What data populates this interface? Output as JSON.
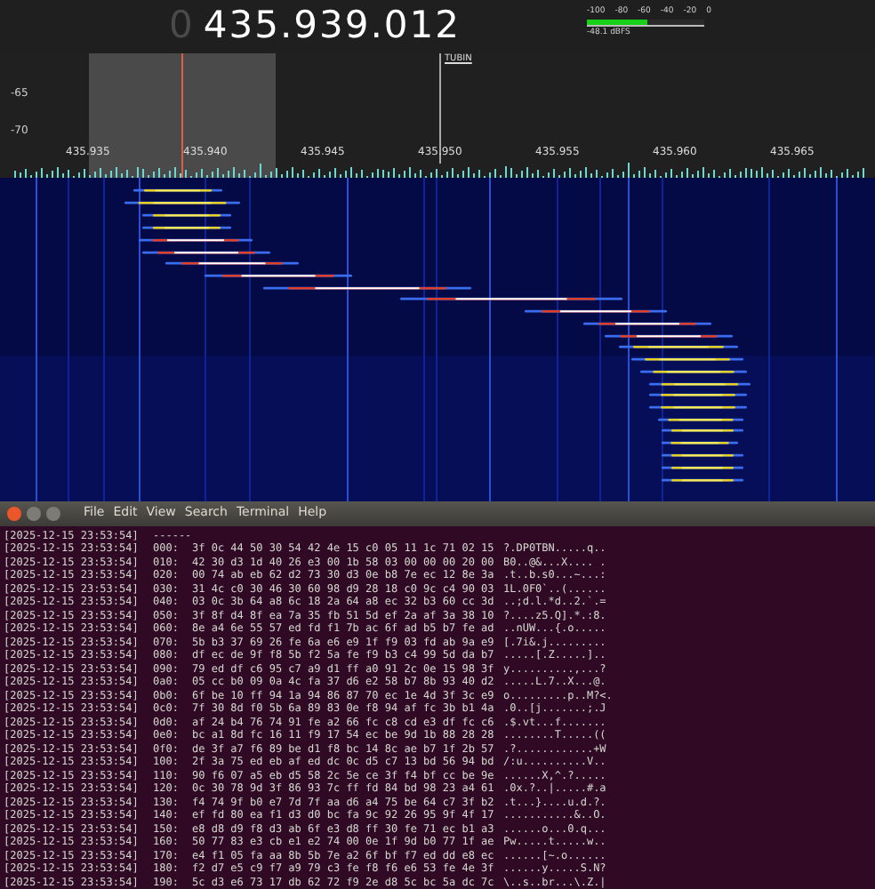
{
  "frequency": {
    "leading_digit": "0",
    "value": "435.939.012"
  },
  "meter": {
    "scale": [
      "-100",
      "-80",
      "-60",
      "-40",
      "-20",
      "0"
    ],
    "level": 0.52,
    "reading": "-48.1 dBFS"
  },
  "spectrum": {
    "y_labels": [
      "-65",
      "-70"
    ],
    "x_labels": [
      "435.935",
      "435.940",
      "435.945",
      "435.950",
      "435.955",
      "435.960",
      "435.965"
    ],
    "marker": "TUBIN"
  },
  "terminal": {
    "menu": [
      "File",
      "Edit",
      "View",
      "Search",
      "Terminal",
      "Help"
    ],
    "lines": [
      {
        "kind": "separator",
        "timestamp": "[2025-12-15 23:53:54]",
        "text": "------"
      },
      {
        "kind": "data",
        "timestamp": "[2025-12-15 23:53:54]",
        "offset": "000:",
        "hex": "3f 0c 44 50 30 54 42 4e 15 c0 05 11 1c 71 02 15",
        "ascii": "?.DP0TBN.....q.."
      },
      {
        "kind": "data",
        "timestamp": "[2025-12-15 23:53:54]",
        "offset": "010:",
        "hex": "42 30 d3 1d 40 26 e3 00 1b 58 03 00 00 00 20 00",
        "ascii": "B0..@&...X.... ."
      },
      {
        "kind": "data",
        "timestamp": "[2025-12-15 23:53:54]",
        "offset": "020:",
        "hex": "00 74 ab eb 62 d2 73 30 d3 0e b8 7e ec 12 8e 3a",
        "ascii": ".t..b.s0...~...:"
      },
      {
        "kind": "data",
        "timestamp": "[2025-12-15 23:53:54]",
        "offset": "030:",
        "hex": "31 4c c0 30 46 30 60 98 d9 28 18 c0 9c c4 90 03",
        "ascii": "1L.0F0`..(......"
      },
      {
        "kind": "data",
        "timestamp": "[2025-12-15 23:53:54]",
        "offset": "040:",
        "hex": "03 0c 3b 64 a8 6c 18 2a 64 a8 ec 32 b3 60 cc 3d",
        "ascii": "..;d.l.*d..2.`.="
      },
      {
        "kind": "data",
        "timestamp": "[2025-12-15 23:53:54]",
        "offset": "050:",
        "hex": "3f 8f d4 8f ea 7a 35 fb 51 5d ef 2a af 3a 38 10",
        "ascii": "?....z5.Q].*.:8."
      },
      {
        "kind": "data",
        "timestamp": "[2025-12-15 23:53:54]",
        "offset": "060:",
        "hex": "8e a4 6e 55 57 ed fd f1 7b ac 6f ad b5 b7 fe ad",
        "ascii": "..nUW...{.o....."
      },
      {
        "kind": "data",
        "timestamp": "[2025-12-15 23:53:54]",
        "offset": "070:",
        "hex": "5b b3 37 69 26 fe 6a e6 e9 1f f9 03 fd ab 9a e9",
        "ascii": "[.7i&.j........."
      },
      {
        "kind": "data",
        "timestamp": "[2025-12-15 23:53:54]",
        "offset": "080:",
        "hex": "df ec de 9f f8 5b f2 5a fe f9 b3 c4 99 5d da b7",
        "ascii": ".....[.Z.....].."
      },
      {
        "kind": "data",
        "timestamp": "[2025-12-15 23:53:54]",
        "offset": "090:",
        "hex": "79 ed df c6 95 c7 a9 d1 ff a0 91 2c 0e 15 98 3f",
        "ascii": "y..........,...?"
      },
      {
        "kind": "data",
        "timestamp": "[2025-12-15 23:53:54]",
        "offset": "0a0:",
        "hex": "05 cc b0 09 0a 4c fa 37 d6 e2 58 b7 8b 93 40 d2",
        "ascii": ".....L.7..X...@."
      },
      {
        "kind": "data",
        "timestamp": "[2025-12-15 23:53:54]",
        "offset": "0b0:",
        "hex": "6f be 10 ff 94 1a 94 86 87 70 ec 1e 4d 3f 3c e9",
        "ascii": "o.........p..M?<."
      },
      {
        "kind": "data",
        "timestamp": "[2025-12-15 23:53:54]",
        "offset": "0c0:",
        "hex": "7f 30 8d f0 5b 6a 89 83 0e f8 94 af fc 3b b1 4a",
        "ascii": ".0..[j.......;.J"
      },
      {
        "kind": "data",
        "timestamp": "[2025-12-15 23:53:54]",
        "offset": "0d0:",
        "hex": "af 24 b4 76 74 91 fe a2 66 fc c8 cd e3 df fc c6",
        "ascii": ".$.vt...f......."
      },
      {
        "kind": "data",
        "timestamp": "[2025-12-15 23:53:54]",
        "offset": "0e0:",
        "hex": "bc a1 8d fc 16 11 f9 17 54 ec be 9d 1b 88 28 28",
        "ascii": "........T.....(("
      },
      {
        "kind": "data",
        "timestamp": "[2025-12-15 23:53:54]",
        "offset": "0f0:",
        "hex": "de 3f a7 f6 89 be d1 f8 bc 14 8c ae b7 1f 2b 57",
        "ascii": ".?............+W"
      },
      {
        "kind": "data",
        "timestamp": "[2025-12-15 23:53:54]",
        "offset": "100:",
        "hex": "2f 3a 75 ed eb af ed dc 0c d5 c7 13 bd 56 94 bd",
        "ascii": "/:u..........V.."
      },
      {
        "kind": "data",
        "timestamp": "[2025-12-15 23:53:54]",
        "offset": "110:",
        "hex": "90 f6 07 a5 eb d5 58 2c 5e ce 3f f4 bf cc be 9e",
        "ascii": "......X,^.?....."
      },
      {
        "kind": "data",
        "timestamp": "[2025-12-15 23:53:54]",
        "offset": "120:",
        "hex": "0c 30 78 9d 3f 86 93 7c ff fd 84 bd 98 23 a4 61",
        "ascii": ".0x.?..|.....#.a"
      },
      {
        "kind": "data",
        "timestamp": "[2025-12-15 23:53:54]",
        "offset": "130:",
        "hex": "f4 74 9f b0 e7 7d 7f aa d6 a4 75 be 64 c7 3f b2",
        "ascii": ".t...}....u.d.?."
      },
      {
        "kind": "data",
        "timestamp": "[2025-12-15 23:53:54]",
        "offset": "140:",
        "hex": "ef fd 80 ea f1 d3 d0 bc fa 9c 92 26 95 9f 4f 17",
        "ascii": "...........&..O."
      },
      {
        "kind": "data",
        "timestamp": "[2025-12-15 23:53:54]",
        "offset": "150:",
        "hex": "e8 d8 d9 f8 d3 ab 6f e3 d8 ff 30 fe 71 ec b1 a3",
        "ascii": "......o...0.q..."
      },
      {
        "kind": "data",
        "timestamp": "[2025-12-15 23:53:54]",
        "offset": "160:",
        "hex": "50 77 83 e3 cb e1 e2 74 00 0e 1f 9d b0 77 1f ae",
        "ascii": "Pw.....t.....w.."
      },
      {
        "kind": "data",
        "timestamp": "[2025-12-15 23:53:54]",
        "offset": "170:",
        "hex": "e4 f1 05 fa aa 8b 5b 7e a2 6f bf f7 ed dd e8 ec",
        "ascii": "......[~.o......"
      },
      {
        "kind": "data",
        "timestamp": "[2025-12-15 23:53:54]",
        "offset": "180:",
        "hex": "f2 d7 e5 c9 f7 a9 79 c3 fe f8 f6 e6 53 fe 4e 3f",
        "ascii": "......y.....S.N?"
      },
      {
        "kind": "data",
        "timestamp": "[2025-12-15 23:53:54]",
        "offset": "190:",
        "hex": "5c d3 e6 73 17 db 62 72 f9 2e d8 5c bc 5a dc 7c",
        "ascii": "\\..s..br...\\.Z.|"
      }
    ]
  }
}
